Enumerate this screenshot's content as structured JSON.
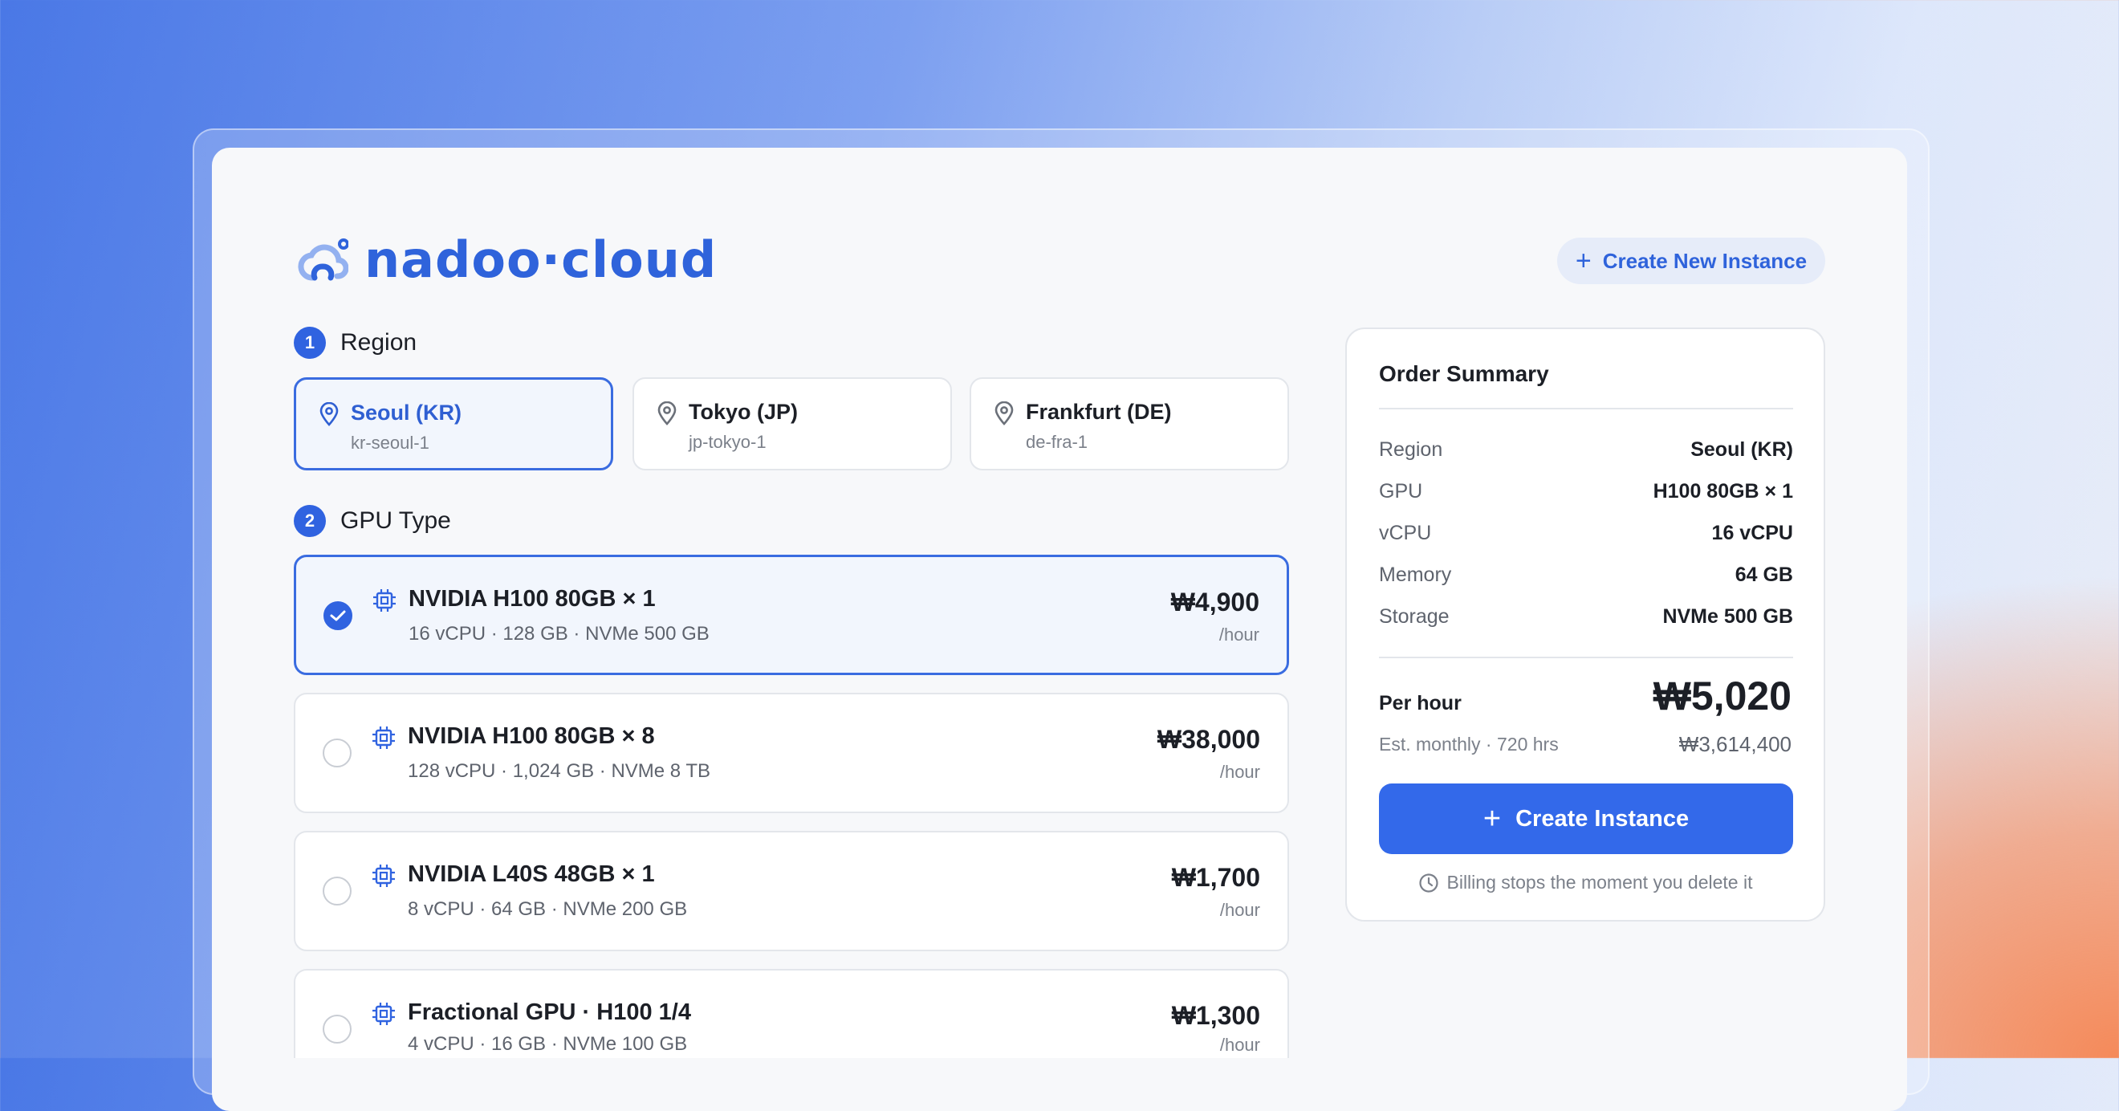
{
  "brand": {
    "name": "nadoo·cloud",
    "color": "#2f63db"
  },
  "header": {
    "create_new_label": "Create New Instance",
    "icon": "plus-icon"
  },
  "steps": [
    {
      "num": "1",
      "label": "Region"
    },
    {
      "num": "2",
      "label": "GPU Type"
    }
  ],
  "regions": [
    {
      "name": "Seoul (KR)",
      "code": "kr-seoul-1",
      "selected": true,
      "icon": "map-pin-icon"
    },
    {
      "name": "Tokyo (JP)",
      "code": "jp-tokyo-1",
      "selected": false,
      "icon": "map-pin-icon"
    },
    {
      "name": "Frankfurt (DE)",
      "code": "de-fra-1",
      "selected": false,
      "icon": "map-pin-icon"
    }
  ],
  "gpus": [
    {
      "name": "NVIDIA H100 80GB × 1",
      "spec": "16 vCPU · 128 GB · NVMe 500 GB",
      "price": "₩4,900",
      "unit": "/hour",
      "selected": true,
      "icon": "chip-icon"
    },
    {
      "name": "NVIDIA H100 80GB × 8",
      "spec": "128 vCPU · 1,024 GB · NVMe 8 TB",
      "price": "₩38,000",
      "unit": "/hour",
      "selected": false,
      "icon": "chip-icon"
    },
    {
      "name": "NVIDIA L40S 48GB × 1",
      "spec": "8 vCPU · 64 GB · NVMe 200 GB",
      "price": "₩1,700",
      "unit": "/hour",
      "selected": false,
      "icon": "chip-icon"
    },
    {
      "name": "Fractional GPU · H100 1/4",
      "spec": "4 vCPU · 16 GB · NVMe 100 GB",
      "price": "₩1,300",
      "unit": "/hour",
      "selected": false,
      "icon": "chip-icon"
    }
  ],
  "summary": {
    "title": "Order Summary",
    "rows": [
      {
        "k": "Region",
        "v": "Seoul (KR)"
      },
      {
        "k": "GPU",
        "v": "H100 80GB × 1"
      },
      {
        "k": "vCPU",
        "v": "16 vCPU"
      },
      {
        "k": "Memory",
        "v": "64 GB"
      },
      {
        "k": "Storage",
        "v": "NVMe 500 GB"
      }
    ],
    "per_hour_label": "Per hour",
    "per_hour_value": "₩5,020",
    "monthly_label": "Est. monthly · 720 hrs",
    "monthly_value": "₩3,614,400",
    "button_label": "Create Instance",
    "billing_note": "Billing stops the moment you delete it",
    "billing_icon": "clock-icon"
  },
  "colors": {
    "accent": "#3063e0",
    "selected_bg": "#f2f6fd"
  }
}
